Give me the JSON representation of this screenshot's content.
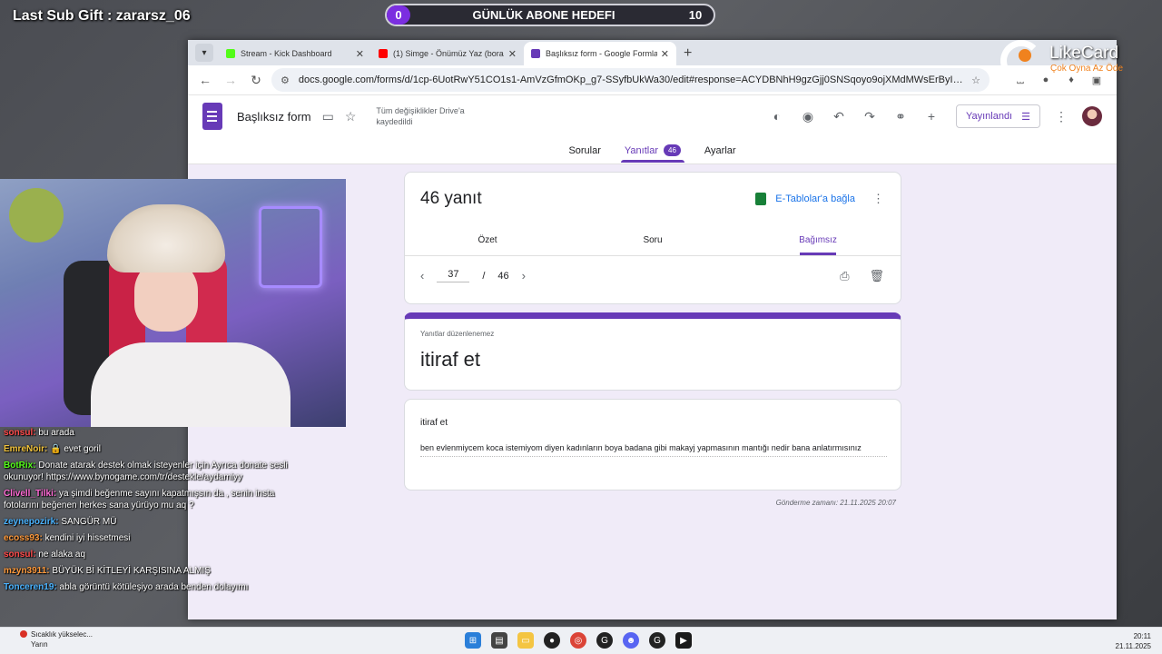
{
  "overlay": {
    "last_sub_gift": "Last Sub Gift : zararsz_06",
    "goal_current": "0",
    "goal_title": "GÜNLÜK ABONE HEDEFI",
    "goal_target": "10"
  },
  "brand": {
    "name": "LikeCard",
    "slogan": "Çok Oyna  Az Öde"
  },
  "browser": {
    "tabs": [
      {
        "title": "Stream - Kick Dashboard",
        "favicon_color": "#53fc18",
        "icon": "kick-icon"
      },
      {
        "title": "(1) Simge - Önümüz Yaz (bora",
        "favicon_color": "#ff0000",
        "icon": "youtube-icon"
      },
      {
        "title": "Başlıksız form - Google Formlar",
        "favicon_color": "#673ab7",
        "icon": "google-forms-icon"
      }
    ],
    "url": "docs.google.com/forms/d/1cp-6UotRwY51CO1s1-AmVzGfmOKp_g7-SSyfbUkWa30/edit#response=ACYDBNhH9gzGjj0SNSqoyo9ojXMdMWsErByIrTI6LG..."
  },
  "forms": {
    "form_name": "Başlıksız form",
    "saved_status": "Tüm değişiklikler Drive'a kaydedildi",
    "publish_label": "Yayınlandı",
    "tabs": {
      "questions": "Sorular",
      "responses": "Yanıtlar",
      "responses_badge": "46",
      "settings": "Ayarlar"
    },
    "response_count": "46 yanıt",
    "sheets_link": "E-Tablolar'a bağla",
    "sub_tabs": {
      "summary": "Özet",
      "question": "Soru",
      "individual": "Bağımsız"
    },
    "pager": {
      "current": "37",
      "separator": "/",
      "total": "46"
    },
    "no_edit_note": "Yanıtlar düzenlenemez",
    "form_title": "itiraf et",
    "question_title": "itiraf et",
    "answer": "ben evlenmiycem koca istemiyom diyen kadınların boya badana gibi makayj yapmasının mantığı nedir bana anlatırmısınız",
    "submitted_at": "Gönderme zamanı: 21.11.2025 20:07"
  },
  "chat": [
    {
      "user": "sonsul:",
      "text": "bu arada",
      "color": "#ff4a4a"
    },
    {
      "user": "EmreNoir:",
      "text": "🔒 evet goril",
      "color": "#f0c23c"
    },
    {
      "user": "BotRix:",
      "text": "Donate atarak destek olmak isteyenler için Ayrıca donate sesli okunuyor! https://www.bynogame.com/tr/destekle/aydamiyy",
      "color": "#53fc18"
    },
    {
      "user": "Clivell_Tilki:",
      "text": "ya şimdi beğenme sayını kapatmışsın da , senin insta fotolarını beğenen herkes sana yürüyo mu aq ?",
      "color": "#ff6ad5"
    },
    {
      "user": "zeynepozirk:",
      "text": "SANGÜR MÜ",
      "color": "#4ab3ff"
    },
    {
      "user": "ecoss93:",
      "text": "kendini iyi hissetmesi",
      "color": "#ff9a3c"
    },
    {
      "user": "sonsul:",
      "text": "ne alaka aq",
      "color": "#ff4a4a"
    },
    {
      "user": "mzyn3911:",
      "text": "BÜYÜK Bİ KİTLEYİ KARŞISINA ALMIŞ",
      "color": "#ff9a3c"
    },
    {
      "user": "Tonceren19:",
      "text": "abla görüntü kötüleşiyo arada benden dolayımı",
      "color": "#4ab3ff"
    }
  ],
  "taskbar": {
    "weather_line1": "Sıcaklık yükselec...",
    "weather_line2": "Yarın",
    "weather_badge": "5",
    "time": "20:11",
    "date": "21.11.2025"
  }
}
